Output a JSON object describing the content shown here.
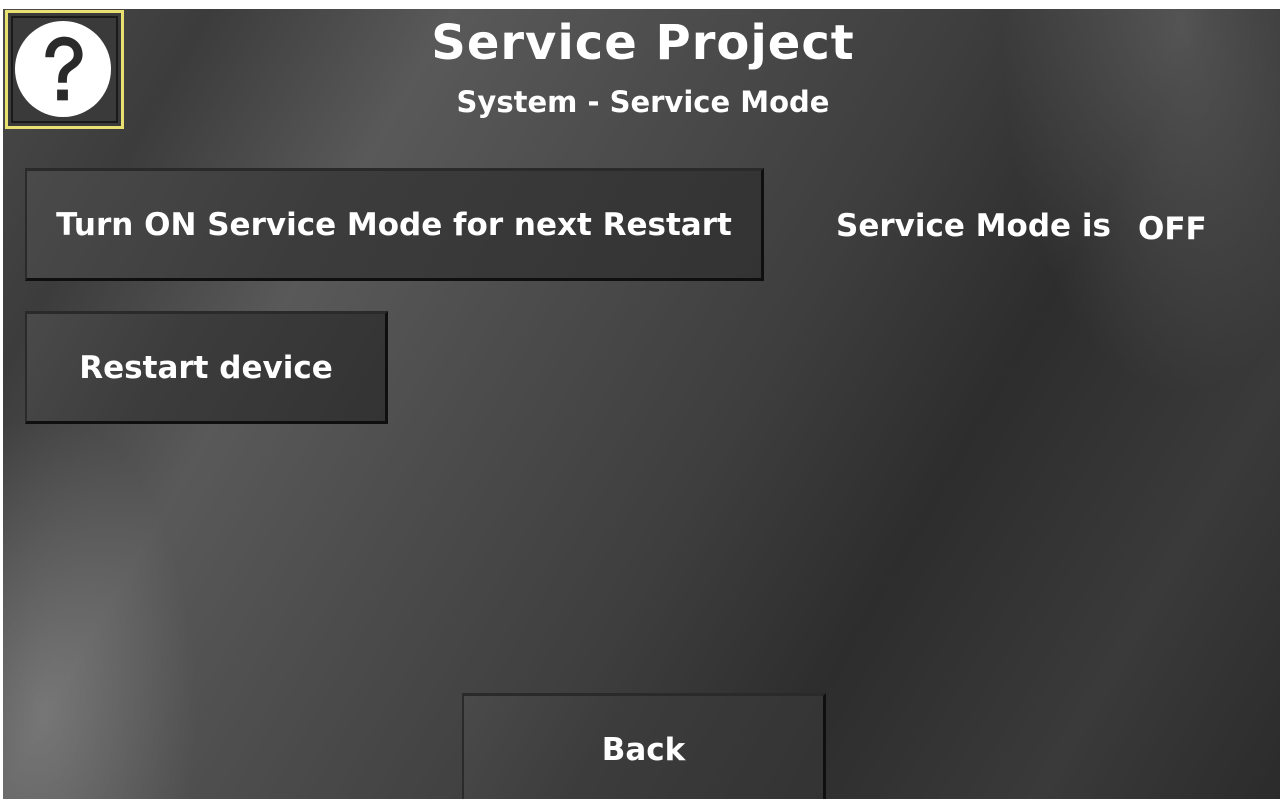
{
  "header": {
    "title": "Service Project",
    "subtitle": "System - Service Mode"
  },
  "help": {
    "icon": "question-mark-icon",
    "highlight_color": "#e8e070"
  },
  "actions": {
    "service_mode_toggle_label": "Turn ON Service Mode for next Restart",
    "restart_label": "Restart device",
    "back_label": "Back"
  },
  "status": {
    "label": "Service Mode is",
    "value": "OFF"
  }
}
